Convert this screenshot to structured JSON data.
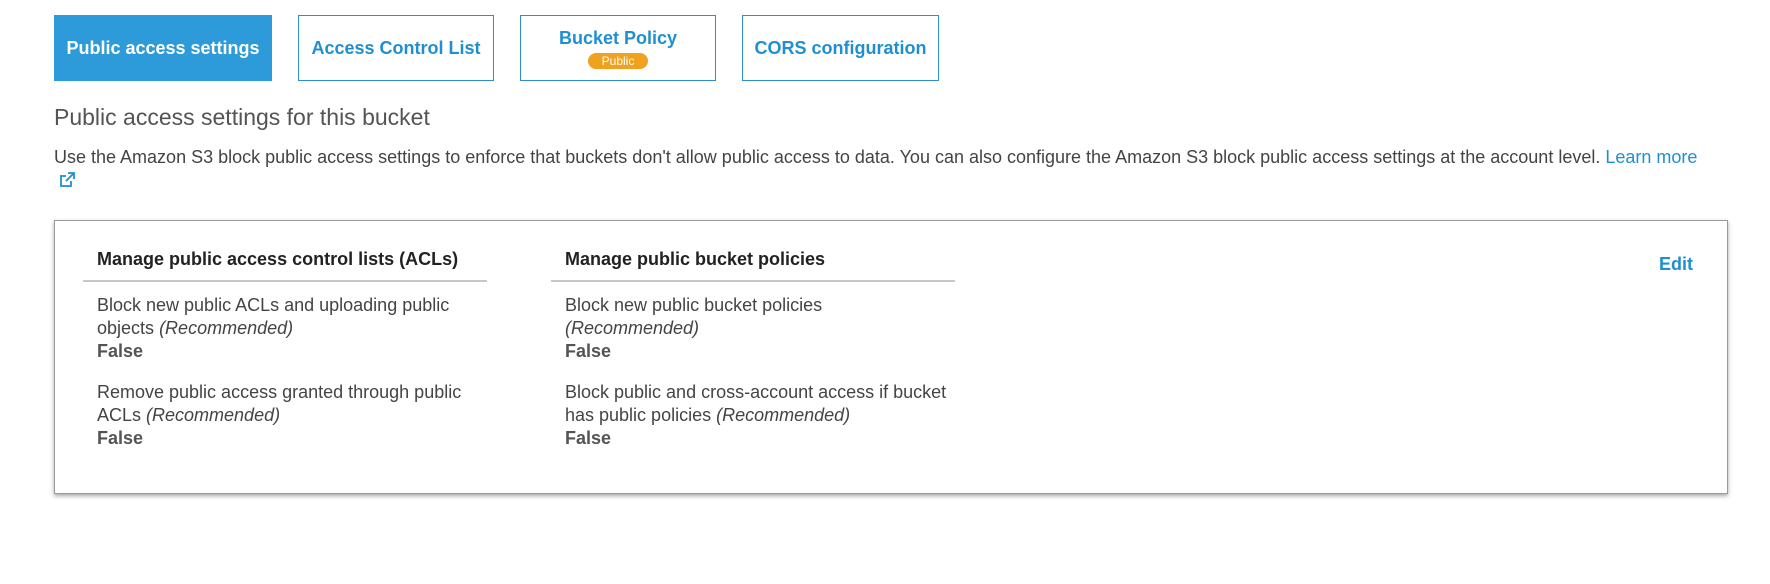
{
  "tabs": [
    {
      "label": "Public access settings",
      "active": true
    },
    {
      "label": "Access Control List",
      "active": false
    },
    {
      "label": "Bucket Policy",
      "badge": "Public",
      "active": false
    },
    {
      "label": "CORS configuration",
      "active": false
    }
  ],
  "section": {
    "title": "Public access settings for this bucket",
    "description": "Use the Amazon S3 block public access settings to enforce that buckets don't allow public access to data. You can also configure the Amazon S3 block public access settings at the account level.",
    "learn_more": "Learn more",
    "learn_more_icon": "external-link-icon"
  },
  "panel": {
    "edit_label": "Edit",
    "acl_column": {
      "heading": "Manage public access control lists (ACLs)",
      "settings": [
        {
          "label": "Block new public ACLs and uploading public objects",
          "note": "(Recommended)",
          "value": "False"
        },
        {
          "label": "Remove public access granted through public ACLs",
          "note": "(Recommended)",
          "value": "False"
        }
      ]
    },
    "policy_column": {
      "heading": "Manage public bucket policies",
      "settings": [
        {
          "label": "Block new public bucket policies",
          "note": "(Recommended)",
          "value": "False"
        },
        {
          "label": "Block public and cross-account access if bucket has public policies",
          "note": "(Recommended)",
          "value": "False"
        }
      ]
    }
  },
  "colors": {
    "accent": "#2d9bda",
    "link": "#1f8fd1",
    "badge": "#f0a21f"
  }
}
